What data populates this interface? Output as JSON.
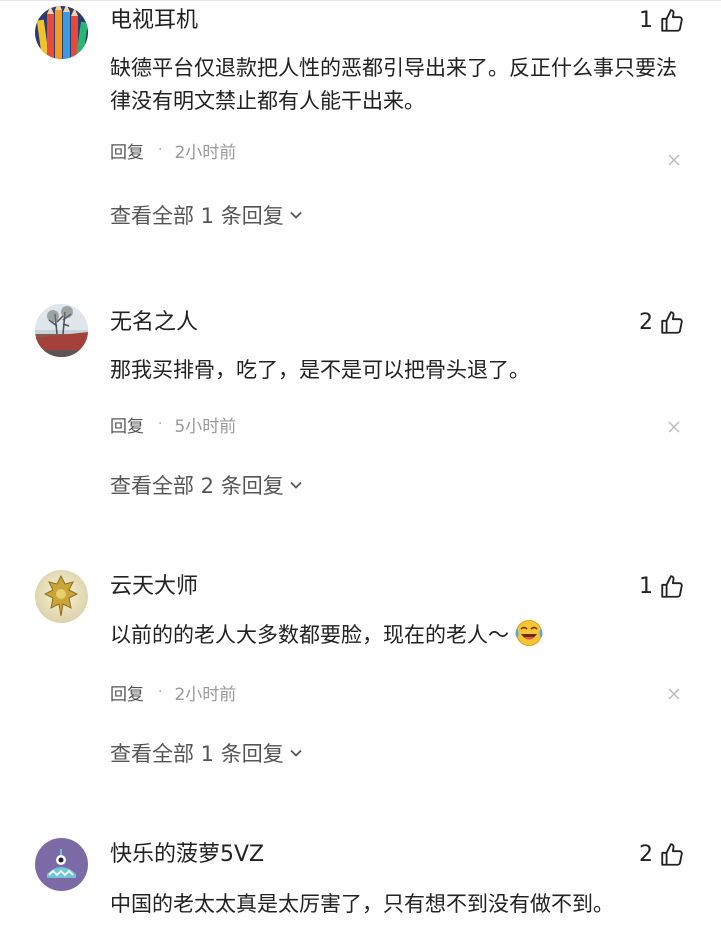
{
  "comments": [
    {
      "username": "电视耳机",
      "likes": "1",
      "text": "缺德平台仅退款把人性的恶都引导出来了。反正什么事只要法律没有明文禁止都有人能干出来。",
      "reply_label": "回复",
      "separator": "·",
      "time": "2小时前",
      "view_replies": "查看全部 1 条回复"
    },
    {
      "username": "无名之人",
      "likes": "2",
      "text": "那我买排骨，吃了，是不是可以把骨头退了。",
      "reply_label": "回复",
      "separator": "·",
      "time": "5小时前",
      "view_replies": "查看全部 2 条回复"
    },
    {
      "username": "云天大师",
      "likes": "1",
      "text": "以前的的老人大多数都要脸，现在的老人～",
      "emoji": "laughing-crying-face-icon",
      "reply_label": "回复",
      "separator": "·",
      "time": "2小时前",
      "view_replies": "查看全部 1 条回复"
    },
    {
      "username": "快乐的菠萝5VZ",
      "likes": "2",
      "text": "中国的老太太真是太厉害了，只有想不到没有做不到。"
    }
  ],
  "colors": {
    "text_primary": "#222222",
    "text_secondary": "#555555",
    "text_muted": "#999999",
    "avatar_4_bg": "#7b6aa6"
  }
}
